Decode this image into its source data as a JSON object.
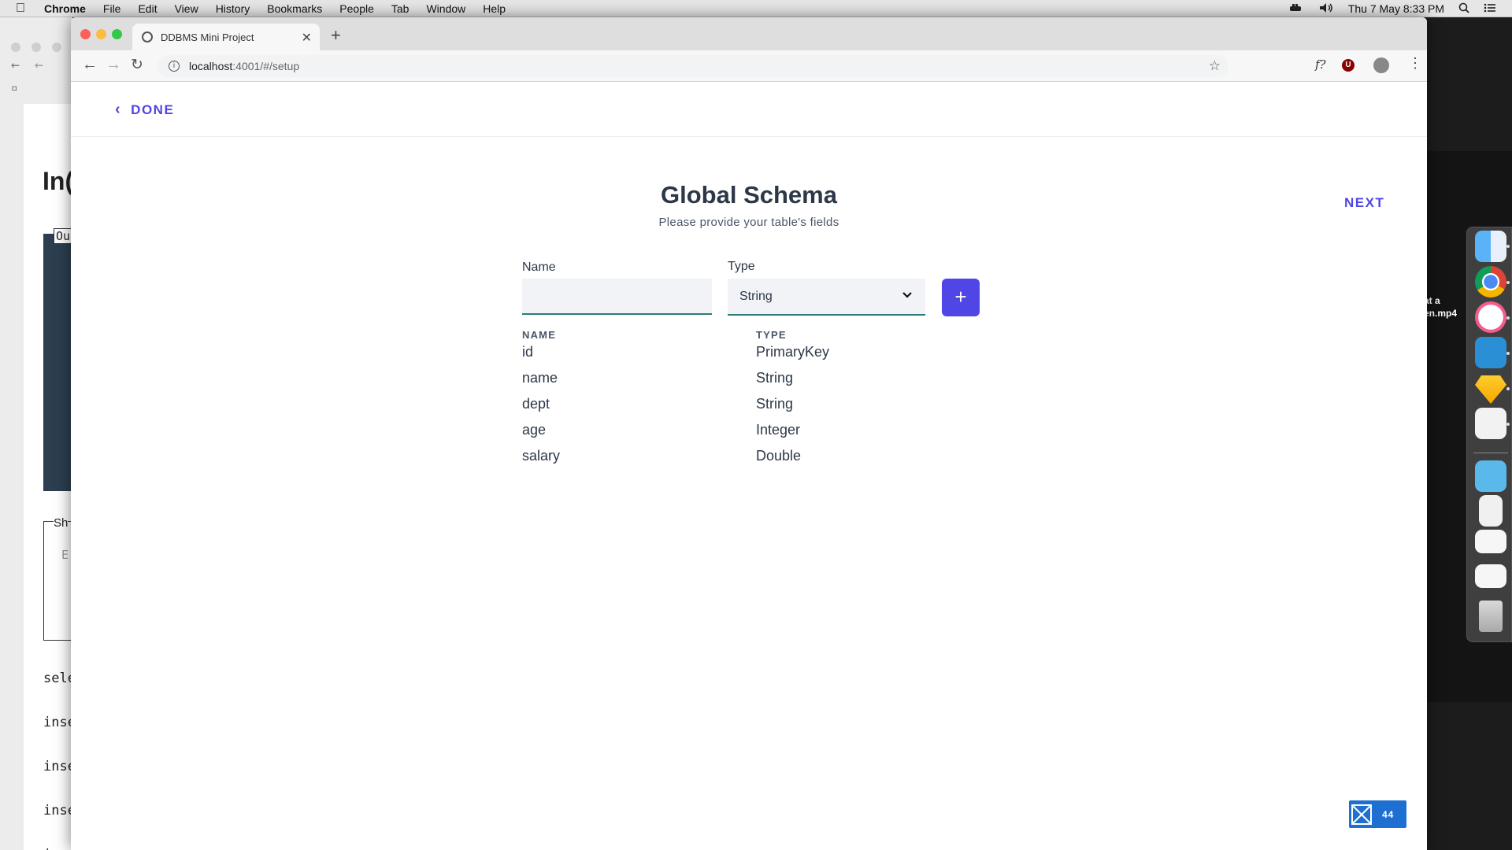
{
  "menubar": {
    "app": "Chrome",
    "items": [
      "File",
      "Edit",
      "View",
      "History",
      "Bookmarks",
      "People",
      "Tab",
      "Window",
      "Help"
    ],
    "clock": "Thu 7 May  8:33 PM"
  },
  "background_window": {
    "heading_fragment": "In(",
    "lines": [
      "sele",
      "inse",
      "inse",
      "inse",
      "inse"
    ],
    "box_labels": [
      "Ou",
      "Sh",
      "E"
    ]
  },
  "desktop": {
    "file_label_1": "at a",
    "file_label_2": "en.mp4"
  },
  "browser": {
    "tab_title": "DDBMS Mini Project",
    "url_host": "localhost",
    "url_path": ":4001/#/setup"
  },
  "page": {
    "done_label": "DONE",
    "next_label": "NEXT",
    "title": "Global Schema",
    "subtitle": "Please provide your table's fields",
    "name_label": "Name",
    "type_label": "Type",
    "name_value": "",
    "type_value": "String",
    "add_label": "+",
    "table_headers": {
      "name": "NAME",
      "type": "TYPE"
    },
    "fields": [
      {
        "name": "id",
        "type": "PrimaryKey"
      },
      {
        "name": "name",
        "type": "String"
      },
      {
        "name": "dept",
        "type": "String"
      },
      {
        "name": "age",
        "type": "Integer"
      },
      {
        "name": "salary",
        "type": "Double"
      }
    ]
  },
  "badge": {
    "count": "44"
  },
  "colors": {
    "accent": "#4f46e5",
    "input_underline": "#2c7a7b",
    "title_text": "#2d3748",
    "badge_bg": "#1d6fd1"
  }
}
